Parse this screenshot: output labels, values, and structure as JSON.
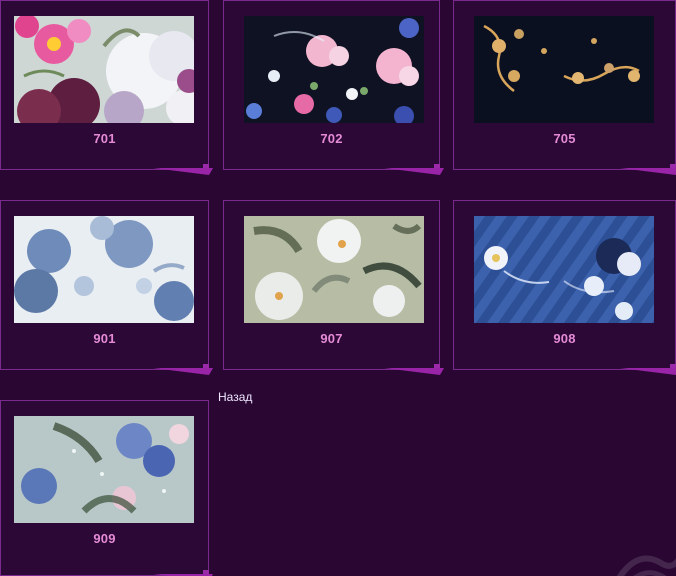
{
  "items": [
    {
      "code": "701"
    },
    {
      "code": "702"
    },
    {
      "code": "705"
    },
    {
      "code": "901"
    },
    {
      "code": "907"
    },
    {
      "code": "908"
    },
    {
      "code": "909"
    }
  ],
  "back_link": "Назад",
  "colors": {
    "background": "#2a0733",
    "card_border": "#7a2a8e",
    "label": "#e58bd6"
  }
}
